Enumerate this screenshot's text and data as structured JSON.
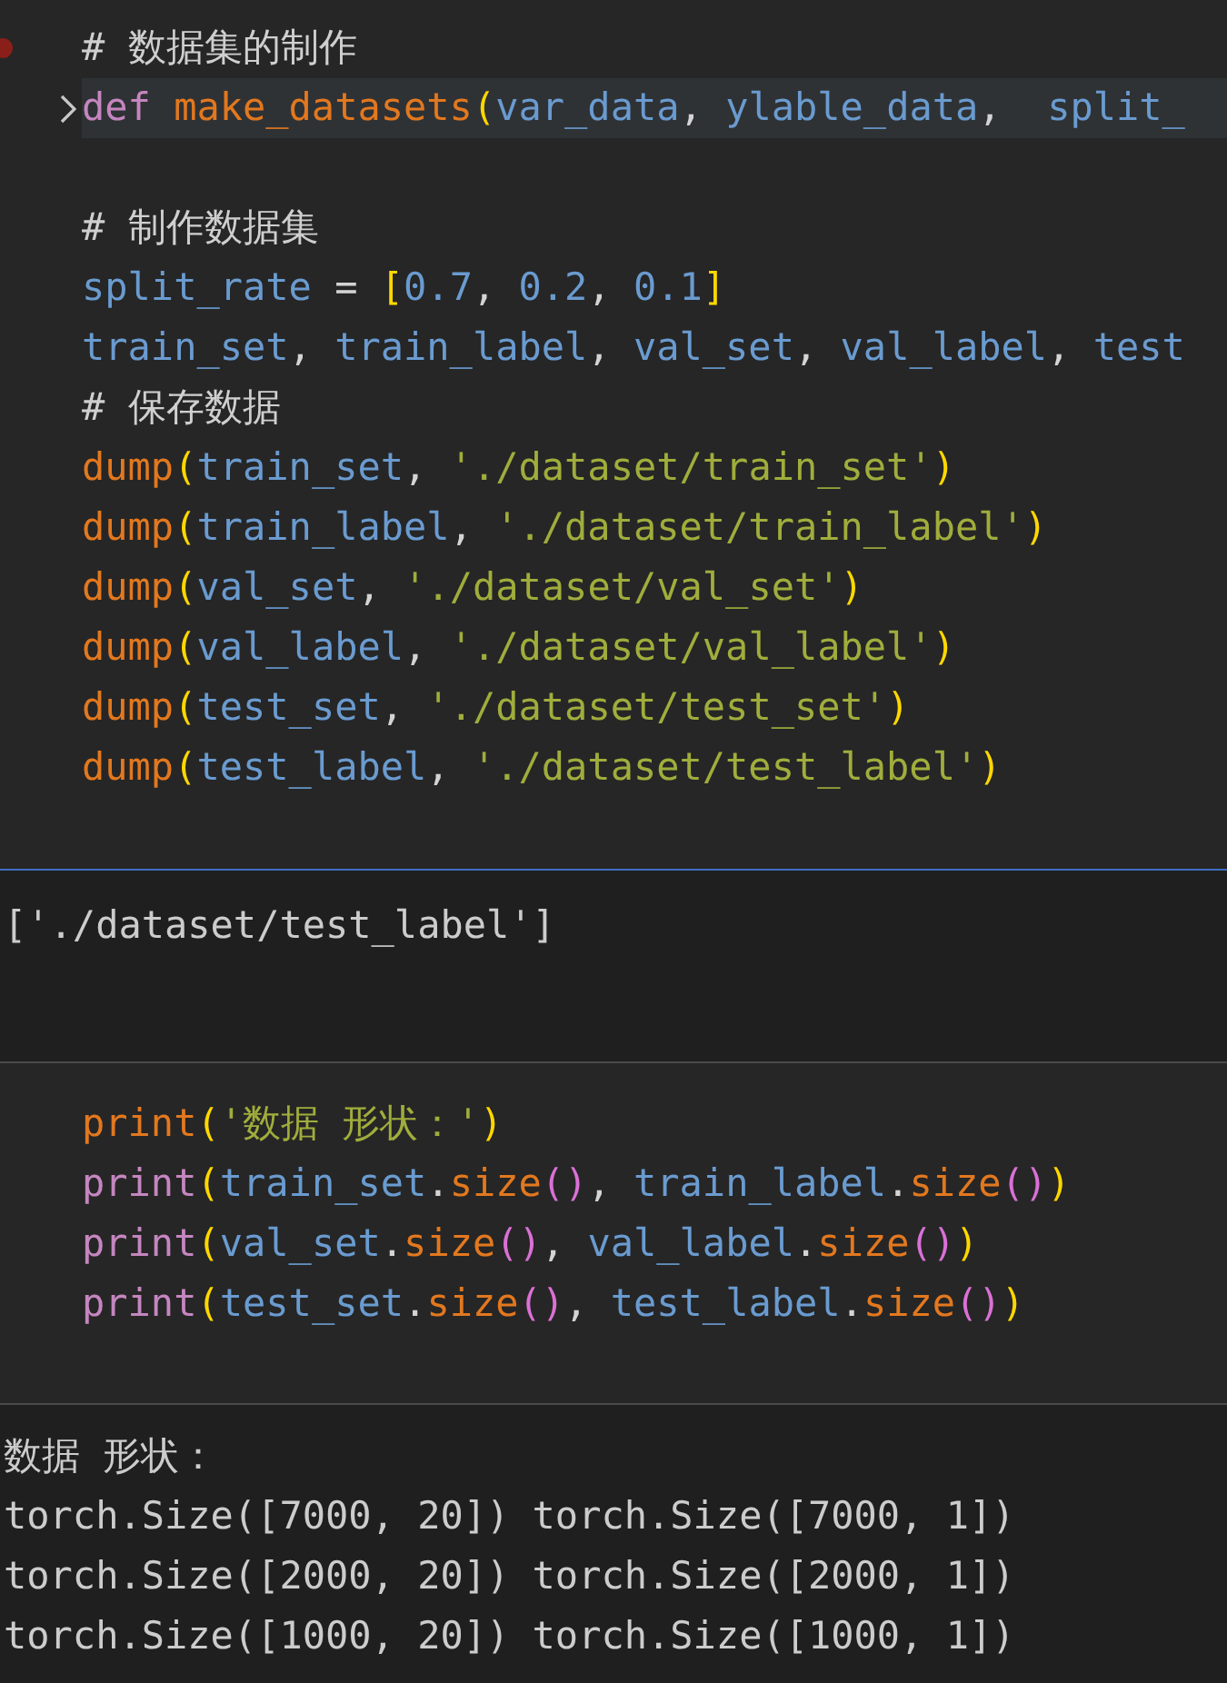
{
  "cells": [
    {
      "kind": "code",
      "focused": true,
      "breakpoint": true,
      "lines": [
        {
          "folded": false,
          "highlighted": false,
          "tokens": [
            {
              "kind": "comment",
              "text": "# 数据集的制作"
            }
          ]
        },
        {
          "folded": true,
          "highlighted": true,
          "tokens": [
            {
              "kind": "keyword",
              "text": "def "
            },
            {
              "kind": "function",
              "text": "make_datasets"
            },
            {
              "kind": "bracket1",
              "text": "("
            },
            {
              "kind": "variable",
              "text": "var_data"
            },
            {
              "kind": "plain",
              "text": ", "
            },
            {
              "kind": "variable",
              "text": "ylable_data"
            },
            {
              "kind": "plain",
              "text": ",  "
            },
            {
              "kind": "variable",
              "text": "split_"
            }
          ]
        },
        {
          "folded": false,
          "highlighted": false
        },
        {
          "folded": false,
          "highlighted": false,
          "tokens": [
            {
              "kind": "comment",
              "text": "# 制作数据集"
            }
          ]
        },
        {
          "folded": false,
          "highlighted": false,
          "tokens": [
            {
              "kind": "variable",
              "text": "split_rate"
            },
            {
              "kind": "plain",
              "text": " = "
            },
            {
              "kind": "bracket1",
              "text": "["
            },
            {
              "kind": "number",
              "text": "0.7"
            },
            {
              "kind": "plain",
              "text": ", "
            },
            {
              "kind": "number",
              "text": "0.2"
            },
            {
              "kind": "plain",
              "text": ", "
            },
            {
              "kind": "number",
              "text": "0.1"
            },
            {
              "kind": "bracket1",
              "text": "]"
            }
          ]
        },
        {
          "folded": false,
          "highlighted": false,
          "tokens": [
            {
              "kind": "variable",
              "text": "train_set"
            },
            {
              "kind": "plain",
              "text": ", "
            },
            {
              "kind": "variable",
              "text": "train_label"
            },
            {
              "kind": "plain",
              "text": ", "
            },
            {
              "kind": "variable",
              "text": "val_set"
            },
            {
              "kind": "plain",
              "text": ", "
            },
            {
              "kind": "variable",
              "text": "val_label"
            },
            {
              "kind": "plain",
              "text": ", "
            },
            {
              "kind": "variable",
              "text": "test"
            }
          ]
        },
        {
          "folded": false,
          "highlighted": false,
          "tokens": [
            {
              "kind": "comment",
              "text": "# 保存数据"
            }
          ]
        },
        {
          "folded": false,
          "highlighted": false,
          "tokens": [
            {
              "kind": "function",
              "text": "dump"
            },
            {
              "kind": "bracket1",
              "text": "("
            },
            {
              "kind": "variable",
              "text": "train_set"
            },
            {
              "kind": "plain",
              "text": ", "
            },
            {
              "kind": "string",
              "text": "'./dataset/train_set'"
            },
            {
              "kind": "bracket1",
              "text": ")"
            }
          ]
        },
        {
          "folded": false,
          "highlighted": false,
          "tokens": [
            {
              "kind": "function",
              "text": "dump"
            },
            {
              "kind": "bracket1",
              "text": "("
            },
            {
              "kind": "variable",
              "text": "train_label"
            },
            {
              "kind": "plain",
              "text": ", "
            },
            {
              "kind": "string",
              "text": "'./dataset/train_label'"
            },
            {
              "kind": "bracket1",
              "text": ")"
            }
          ]
        },
        {
          "folded": false,
          "highlighted": false,
          "tokens": [
            {
              "kind": "function",
              "text": "dump"
            },
            {
              "kind": "bracket1",
              "text": "("
            },
            {
              "kind": "variable",
              "text": "val_set"
            },
            {
              "kind": "plain",
              "text": ", "
            },
            {
              "kind": "string",
              "text": "'./dataset/val_set'"
            },
            {
              "kind": "bracket1",
              "text": ")"
            }
          ]
        },
        {
          "folded": false,
          "highlighted": false,
          "tokens": [
            {
              "kind": "function",
              "text": "dump"
            },
            {
              "kind": "bracket1",
              "text": "("
            },
            {
              "kind": "variable",
              "text": "val_label"
            },
            {
              "kind": "plain",
              "text": ", "
            },
            {
              "kind": "string",
              "text": "'./dataset/val_label'"
            },
            {
              "kind": "bracket1",
              "text": ")"
            }
          ]
        },
        {
          "folded": false,
          "highlighted": false,
          "tokens": [
            {
              "kind": "function",
              "text": "dump"
            },
            {
              "kind": "bracket1",
              "text": "("
            },
            {
              "kind": "variable",
              "text": "test_set"
            },
            {
              "kind": "plain",
              "text": ", "
            },
            {
              "kind": "string",
              "text": "'./dataset/test_set'"
            },
            {
              "kind": "bracket1",
              "text": ")"
            }
          ]
        },
        {
          "folded": false,
          "highlighted": false,
          "tokens": [
            {
              "kind": "function",
              "text": "dump"
            },
            {
              "kind": "bracket1",
              "text": "("
            },
            {
              "kind": "variable",
              "text": "test_label"
            },
            {
              "kind": "plain",
              "text": ", "
            },
            {
              "kind": "string",
              "text": "'./dataset/test_label'"
            },
            {
              "kind": "bracket1",
              "text": ")"
            }
          ]
        }
      ]
    },
    {
      "kind": "output",
      "lines": [
        "['./dataset/test_label']"
      ]
    },
    {
      "kind": "code",
      "focused": false,
      "breakpoint": false,
      "lines": [
        {
          "folded": false,
          "highlighted": false,
          "tokens": [
            {
              "kind": "function",
              "text": "print"
            },
            {
              "kind": "bracket1",
              "text": "("
            },
            {
              "kind": "string",
              "text": "'数据 形状：'"
            },
            {
              "kind": "bracket1",
              "text": ")"
            }
          ]
        },
        {
          "folded": false,
          "highlighted": false,
          "tokens": [
            {
              "kind": "keyword",
              "text": "print"
            },
            {
              "kind": "bracket1",
              "text": "("
            },
            {
              "kind": "variable",
              "text": "train_set"
            },
            {
              "kind": "plain",
              "text": "."
            },
            {
              "kind": "function",
              "text": "size"
            },
            {
              "kind": "bracket2",
              "text": "()"
            },
            {
              "kind": "plain",
              "text": ", "
            },
            {
              "kind": "variable",
              "text": "train_label"
            },
            {
              "kind": "plain",
              "text": "."
            },
            {
              "kind": "function",
              "text": "size"
            },
            {
              "kind": "bracket2",
              "text": "()"
            },
            {
              "kind": "bracket1",
              "text": ")"
            }
          ]
        },
        {
          "folded": false,
          "highlighted": false,
          "tokens": [
            {
              "kind": "keyword",
              "text": "print"
            },
            {
              "kind": "bracket1",
              "text": "("
            },
            {
              "kind": "variable",
              "text": "val_set"
            },
            {
              "kind": "plain",
              "text": "."
            },
            {
              "kind": "function",
              "text": "size"
            },
            {
              "kind": "bracket2",
              "text": "()"
            },
            {
              "kind": "plain",
              "text": ", "
            },
            {
              "kind": "variable",
              "text": "val_label"
            },
            {
              "kind": "plain",
              "text": "."
            },
            {
              "kind": "function",
              "text": "size"
            },
            {
              "kind": "bracket2",
              "text": "()"
            },
            {
              "kind": "bracket1",
              "text": ")"
            }
          ]
        },
        {
          "folded": false,
          "highlighted": false,
          "tokens": [
            {
              "kind": "keyword",
              "text": "print"
            },
            {
              "kind": "bracket1",
              "text": "("
            },
            {
              "kind": "variable",
              "text": "test_set"
            },
            {
              "kind": "plain",
              "text": "."
            },
            {
              "kind": "function",
              "text": "size"
            },
            {
              "kind": "bracket2",
              "text": "()"
            },
            {
              "kind": "plain",
              "text": ", "
            },
            {
              "kind": "variable",
              "text": "test_label"
            },
            {
              "kind": "plain",
              "text": "."
            },
            {
              "kind": "function",
              "text": "size"
            },
            {
              "kind": "bracket2",
              "text": "()"
            },
            {
              "kind": "bracket1",
              "text": ")"
            }
          ]
        }
      ]
    },
    {
      "kind": "output",
      "lines": [
        "数据 形状：",
        "torch.Size([7000, 20]) torch.Size([7000, 1])",
        "torch.Size([2000, 20]) torch.Size([2000, 1])",
        "torch.Size([1000, 20]) torch.Size([1000, 1])"
      ]
    }
  ]
}
